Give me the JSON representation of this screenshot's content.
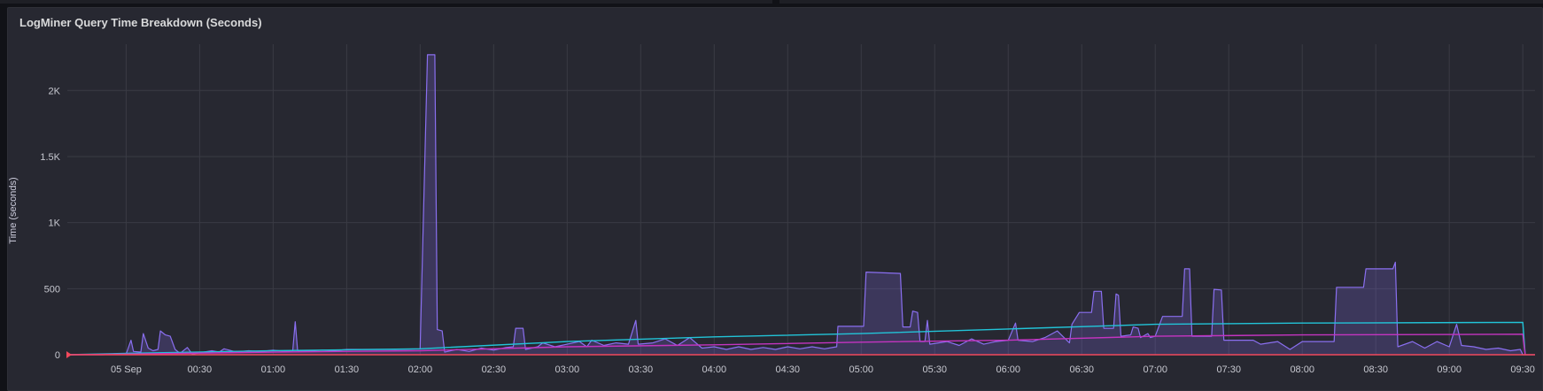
{
  "panel": {
    "title": "LogMiner Query Time Breakdown (Seconds)"
  },
  "colors": {
    "background": "#272831",
    "grid": "#3a3b44",
    "purple": "#8a6ff0",
    "cyan": "#22c4d8",
    "magenta": "#c434c0",
    "red": "#f2495c"
  },
  "chart_data": {
    "type": "area",
    "title": "LogMiner Query Time Breakdown (Seconds)",
    "xlabel": "",
    "ylabel": "Time (seconds)",
    "ylim": [
      0,
      2350
    ],
    "yticks": [
      0,
      500,
      1000,
      1500,
      2000
    ],
    "ytick_labels": [
      "0",
      "500",
      "1K",
      "1.5K",
      "2K"
    ],
    "xlim_minutes": [
      -24,
      575
    ],
    "xticks_minutes": [
      0,
      30,
      60,
      90,
      120,
      150,
      180,
      210,
      240,
      270,
      300,
      330,
      360,
      390,
      420,
      450,
      480,
      510,
      540,
      570
    ],
    "xtick_labels": [
      "05 Sep",
      "00:30",
      "01:00",
      "01:30",
      "02:00",
      "02:30",
      "03:00",
      "03:30",
      "04:00",
      "04:30",
      "05:00",
      "05:30",
      "06:00",
      "06:30",
      "07:00",
      "07:30",
      "08:00",
      "08:30",
      "09:00",
      "09:30"
    ],
    "grid": true,
    "legend": "none",
    "series": [
      {
        "color": "#8a6ff0",
        "fill": true,
        "points": [
          [
            -24,
            0
          ],
          [
            -10,
            0
          ],
          [
            0,
            5
          ],
          [
            2,
            110
          ],
          [
            3,
            25
          ],
          [
            6,
            20
          ],
          [
            7,
            160
          ],
          [
            9,
            50
          ],
          [
            11,
            30
          ],
          [
            13,
            40
          ],
          [
            14,
            180
          ],
          [
            16,
            150
          ],
          [
            18,
            140
          ],
          [
            20,
            40
          ],
          [
            22,
            10
          ],
          [
            25,
            55
          ],
          [
            27,
            5
          ],
          [
            30,
            15
          ],
          [
            35,
            30
          ],
          [
            38,
            20
          ],
          [
            40,
            45
          ],
          [
            45,
            20
          ],
          [
            50,
            30
          ],
          [
            55,
            25
          ],
          [
            60,
            35
          ],
          [
            65,
            25
          ],
          [
            68,
            30
          ],
          [
            69,
            250
          ],
          [
            70,
            30
          ],
          [
            75,
            28
          ],
          [
            80,
            35
          ],
          [
            85,
            30
          ],
          [
            90,
            40
          ],
          [
            110,
            40
          ],
          [
            120,
            45
          ],
          [
            123,
            2270
          ],
          [
            126,
            2270
          ],
          [
            127,
            190
          ],
          [
            129,
            180
          ],
          [
            130,
            20
          ],
          [
            135,
            40
          ],
          [
            140,
            25
          ],
          [
            145,
            50
          ],
          [
            150,
            35
          ],
          [
            155,
            55
          ],
          [
            158,
            60
          ],
          [
            159,
            200
          ],
          [
            162,
            200
          ],
          [
            163,
            40
          ],
          [
            168,
            60
          ],
          [
            170,
            90
          ],
          [
            175,
            60
          ],
          [
            180,
            80
          ],
          [
            185,
            100
          ],
          [
            188,
            60
          ],
          [
            190,
            110
          ],
          [
            195,
            70
          ],
          [
            200,
            90
          ],
          [
            205,
            80
          ],
          [
            208,
            260
          ],
          [
            209,
            80
          ],
          [
            215,
            90
          ],
          [
            220,
            120
          ],
          [
            225,
            70
          ],
          [
            230,
            130
          ],
          [
            235,
            50
          ],
          [
            240,
            60
          ],
          [
            245,
            40
          ],
          [
            250,
            60
          ],
          [
            255,
            40
          ],
          [
            260,
            55
          ],
          [
            265,
            40
          ],
          [
            270,
            60
          ],
          [
            275,
            45
          ],
          [
            280,
            60
          ],
          [
            285,
            45
          ],
          [
            290,
            60
          ],
          [
            290.5,
            215
          ],
          [
            301,
            215
          ],
          [
            302,
            625
          ],
          [
            316,
            615
          ],
          [
            317,
            210
          ],
          [
            320,
            210
          ],
          [
            321,
            330
          ],
          [
            323,
            320
          ],
          [
            324,
            100
          ],
          [
            326,
            100
          ],
          [
            327,
            260
          ],
          [
            328,
            80
          ],
          [
            335,
            100
          ],
          [
            340,
            70
          ],
          [
            345,
            120
          ],
          [
            350,
            80
          ],
          [
            355,
            100
          ],
          [
            360,
            110
          ],
          [
            363,
            240
          ],
          [
            364,
            110
          ],
          [
            370,
            100
          ],
          [
            375,
            130
          ],
          [
            380,
            180
          ],
          [
            385,
            90
          ],
          [
            386,
            230
          ],
          [
            389,
            320
          ],
          [
            394,
            320
          ],
          [
            395,
            480
          ],
          [
            398,
            480
          ],
          [
            399,
            200
          ],
          [
            403,
            200
          ],
          [
            404,
            460
          ],
          [
            405,
            450
          ],
          [
            406,
            140
          ],
          [
            410,
            150
          ],
          [
            411,
            210
          ],
          [
            413,
            200
          ],
          [
            414,
            130
          ],
          [
            417,
            160
          ],
          [
            418,
            130
          ],
          [
            420,
            140
          ],
          [
            423,
            290
          ],
          [
            431,
            290
          ],
          [
            432,
            650
          ],
          [
            434,
            650
          ],
          [
            435,
            140
          ],
          [
            443,
            140
          ],
          [
            444,
            495
          ],
          [
            447,
            490
          ],
          [
            448,
            110
          ],
          [
            460,
            110
          ],
          [
            463,
            80
          ],
          [
            470,
            100
          ],
          [
            475,
            40
          ],
          [
            480,
            100
          ],
          [
            485,
            100
          ],
          [
            486,
            100
          ],
          [
            493,
            100
          ],
          [
            494,
            510
          ],
          [
            505,
            510
          ],
          [
            506,
            650
          ],
          [
            517,
            650
          ],
          [
            518,
            700
          ],
          [
            519,
            60
          ],
          [
            525,
            100
          ],
          [
            530,
            50
          ],
          [
            535,
            100
          ],
          [
            540,
            60
          ],
          [
            543,
            230
          ],
          [
            545,
            70
          ],
          [
            550,
            60
          ],
          [
            555,
            40
          ],
          [
            560,
            50
          ],
          [
            565,
            30
          ],
          [
            569,
            40
          ],
          [
            570,
            0
          ],
          [
            575,
            0
          ]
        ]
      },
      {
        "color": "#22c4d8",
        "fill": false,
        "points": [
          [
            -24,
            0
          ],
          [
            0,
            10
          ],
          [
            60,
            30
          ],
          [
            120,
            45
          ],
          [
            180,
            100
          ],
          [
            240,
            135
          ],
          [
            300,
            160
          ],
          [
            360,
            195
          ],
          [
            420,
            230
          ],
          [
            480,
            240
          ],
          [
            570,
            245
          ],
          [
            571,
            0
          ]
        ]
      },
      {
        "color": "#c434c0",
        "fill": false,
        "points": [
          [
            -24,
            0
          ],
          [
            0,
            5
          ],
          [
            60,
            20
          ],
          [
            120,
            30
          ],
          [
            180,
            60
          ],
          [
            240,
            75
          ],
          [
            300,
            95
          ],
          [
            360,
            110
          ],
          [
            420,
            140
          ],
          [
            480,
            150
          ],
          [
            570,
            155
          ],
          [
            571,
            0
          ]
        ]
      },
      {
        "color": "#f2495c",
        "fill": false,
        "points": [
          [
            -24,
            0
          ],
          [
            575,
            0
          ]
        ]
      }
    ]
  }
}
